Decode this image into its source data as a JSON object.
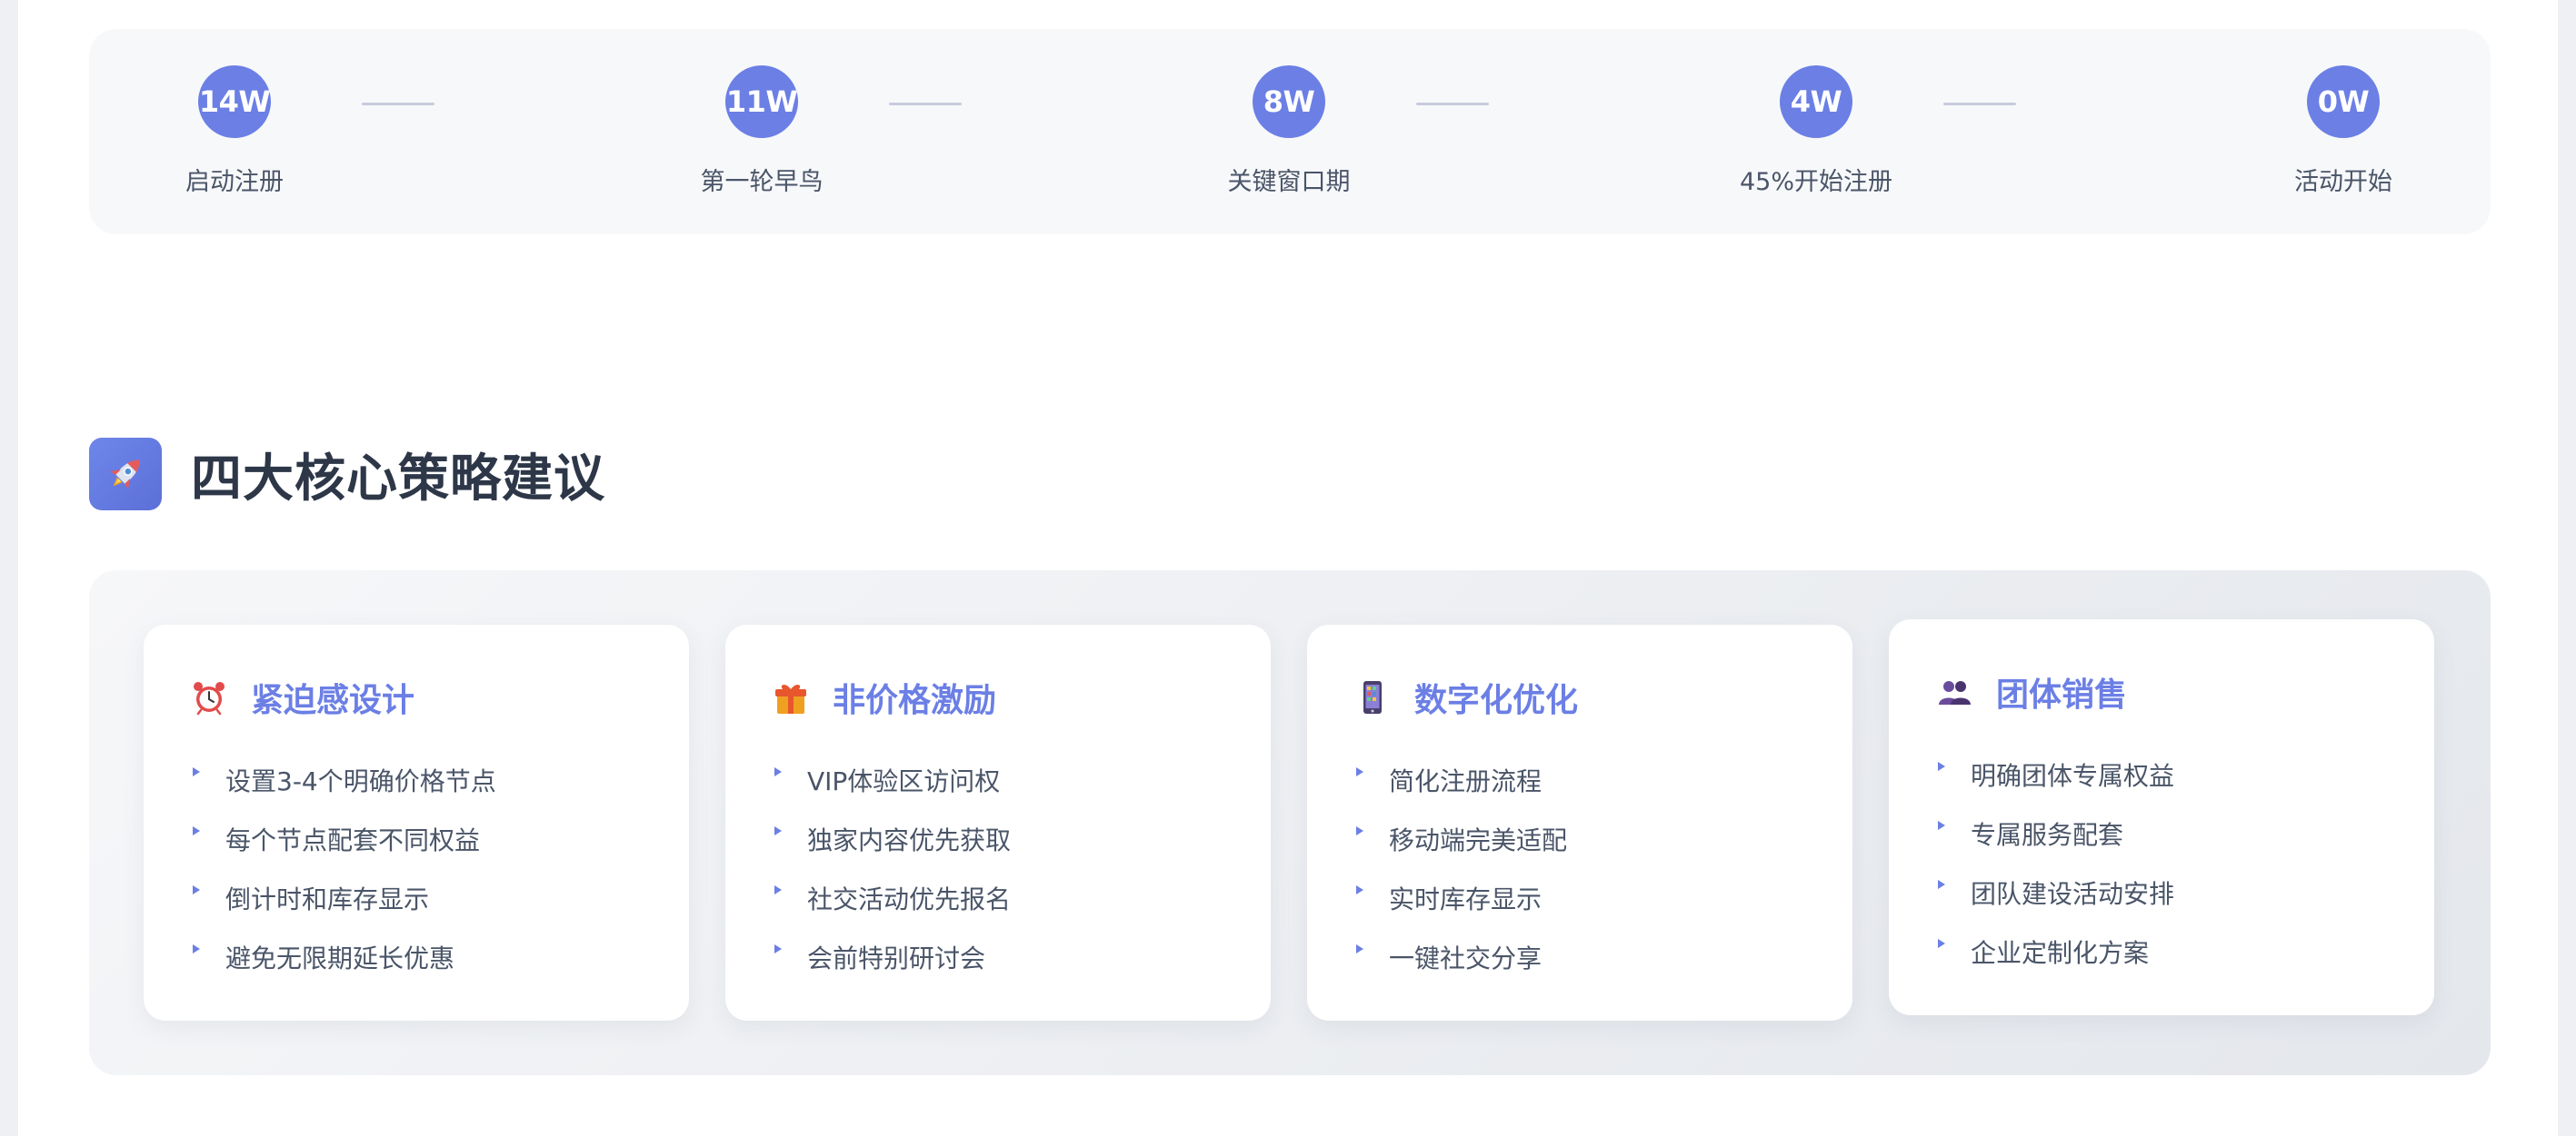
{
  "timeline": {
    "milestones": [
      {
        "value": "14W",
        "label": "启动注册"
      },
      {
        "value": "11W",
        "label": "第一轮早鸟"
      },
      {
        "value": "8W",
        "label": "关键窗口期"
      },
      {
        "value": "4W",
        "label": "45%开始注册"
      },
      {
        "value": "0W",
        "label": "活动开始"
      }
    ]
  },
  "strategies": {
    "icon": "rocket-icon",
    "title": "四大核心策略建议",
    "cards": [
      {
        "icon": "alarm-clock-icon",
        "title": "紧迫感设计",
        "items": [
          "设置3-4个明确价格节点",
          "每个节点配套不同权益",
          "倒计时和库存显示",
          "避免无限期延长优惠"
        ]
      },
      {
        "icon": "gift-icon",
        "title": "非价格激励",
        "items": [
          "VIP体验区访问权",
          "独家内容优先获取",
          "社交活动优先报名",
          "会前特别研讨会"
        ]
      },
      {
        "icon": "mobile-phone-icon",
        "title": "数字化优化",
        "items": [
          "简化注册流程",
          "移动端完美适配",
          "实时库存显示",
          "一键社交分享"
        ]
      },
      {
        "icon": "people-group-icon",
        "title": "团体销售",
        "items": [
          "明确团体专属权益",
          "专属服务配套",
          "团队建设活动安排",
          "企业定制化方案"
        ]
      }
    ]
  },
  "colors": {
    "accent": "#6b7fe5",
    "heading": "#2d3748",
    "text": "#4a5568",
    "timeline_bg": "#f7f8fa"
  }
}
